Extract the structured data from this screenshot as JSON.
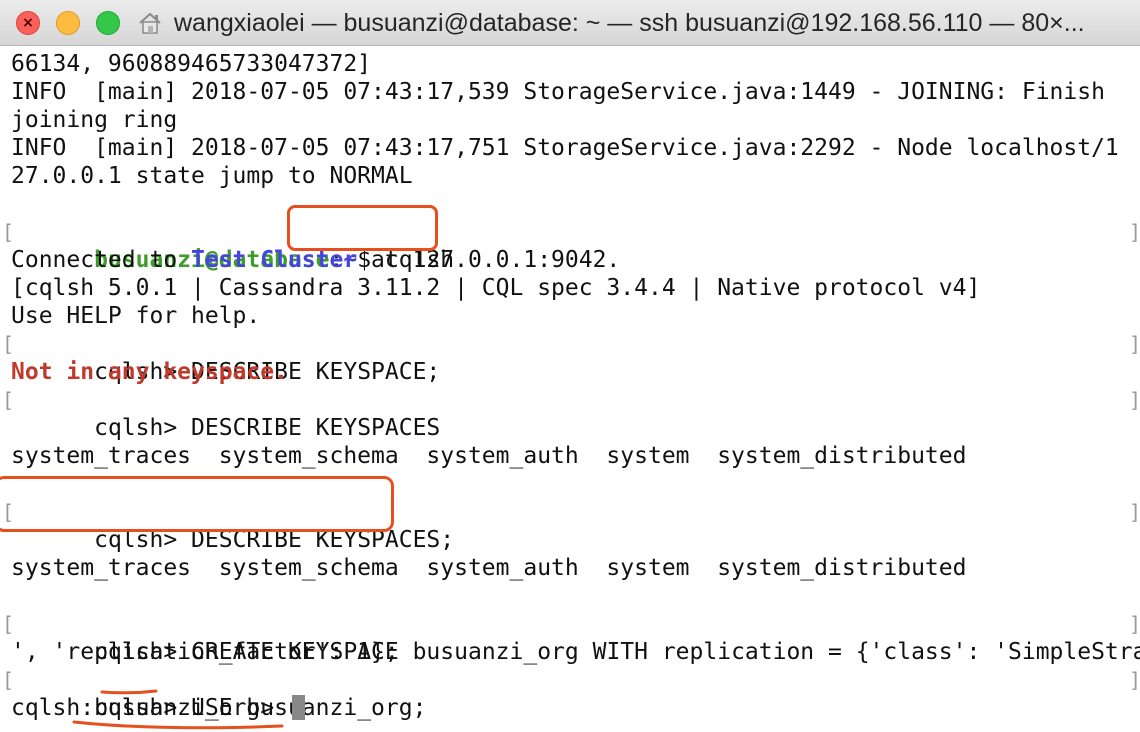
{
  "window": {
    "title": "wangxiaolei — busuanzi@database: ~ — ssh busuanzi@192.168.56.110 — 80×..."
  },
  "colors": {
    "user": "#3e9c2a",
    "path": "#3b3bd8",
    "cluster": "#4444e0",
    "error": "#c0392b",
    "annotation": "#e6501e"
  },
  "terminal": {
    "lines": [
      {
        "text": "66134, 960889465733047372]"
      },
      {
        "text": "INFO  [main] 2018-07-05 07:43:17,539 StorageService.java:1449 - JOINING: Finish"
      },
      {
        "text": "joining ring"
      },
      {
        "text": "INFO  [main] 2018-07-05 07:43:17,751 StorageService.java:2292 - Node localhost/1"
      },
      {
        "text": "27.0.0.1 state jump to NORMAL"
      },
      {
        "text": ""
      },
      {
        "prompt_user": "busuanzi@database",
        "prompt_colon": ":",
        "prompt_path": "~",
        "prompt_symbol": "$ ",
        "command": "cqlsh"
      },
      {
        "prefix": "Connected to ",
        "cluster": "Test Cluster",
        "suffix": " at 127.0.0.1:9042."
      },
      {
        "text": "[cqlsh 5.0.1 | Cassandra 3.11.2 | CQL spec 3.4.4 | Native protocol v4]"
      },
      {
        "text": "Use HELP for help."
      },
      {
        "text": "cqlsh> DESCRIBE KEYSPACE;"
      },
      {
        "text": "Not in any keyspace."
      },
      {
        "text": "cqlsh> DESCRIBE KEYSPACES"
      },
      {
        "text": ""
      },
      {
        "text": "system_traces  system_schema  system_auth  system  system_distributed"
      },
      {
        "text": ""
      },
      {
        "text": "cqlsh> DESCRIBE KEYSPACES;"
      },
      {
        "text": ""
      },
      {
        "text": "system_traces  system_schema  system_auth  system  system_distributed"
      },
      {
        "text": ""
      },
      {
        "text": "cqlsh> CREATE KEYSPACE busuanzi_org WITH replication = {'class': 'SimpleStrategy"
      },
      {
        "text": "', 'replication_factor': 1};"
      },
      {
        "text": "cqlsh> USE busuanzi_org;"
      },
      {
        "text": "cqlsh:busuanzi_org> "
      }
    ]
  }
}
